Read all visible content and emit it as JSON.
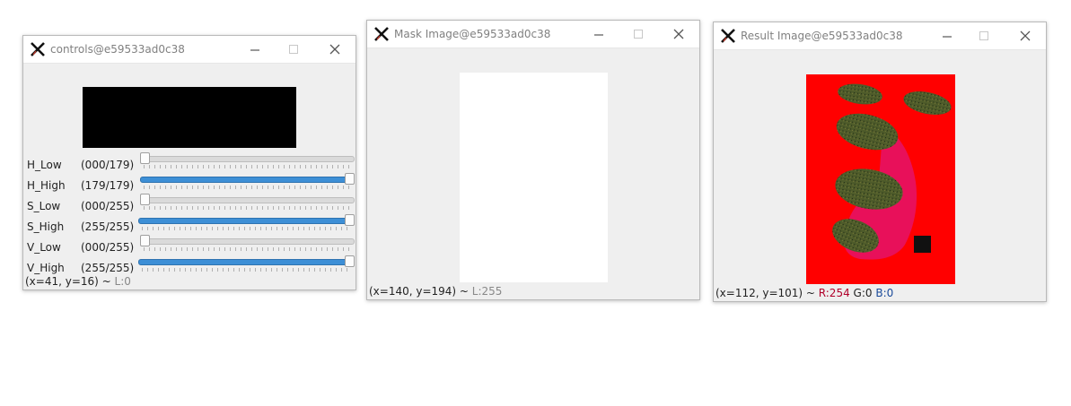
{
  "controls_window": {
    "title": "controls@e59533ad0c38",
    "trackbars": [
      {
        "label": "H_Low",
        "value_text": "(000/179)",
        "value": 0,
        "max": 179
      },
      {
        "label": "H_High",
        "value_text": "(179/179)",
        "value": 179,
        "max": 179
      },
      {
        "label": "S_Low",
        "value_text": "(000/255)",
        "value": 0,
        "max": 255
      },
      {
        "label": "S_High",
        "value_text": "(255/255)",
        "value": 255,
        "max": 255
      },
      {
        "label": "V_Low",
        "value_text": "(000/255)",
        "value": 0,
        "max": 255
      },
      {
        "label": "V_High",
        "value_text": "(255/255)",
        "value": 255,
        "max": 255
      }
    ],
    "status": {
      "coords": "(x=41, y=16) ~ ",
      "l": "L:0"
    }
  },
  "mask_window": {
    "title": "Mask Image@e59533ad0c38",
    "status": {
      "coords": "(x=140, y=194) ~ ",
      "l": "L:255"
    }
  },
  "result_window": {
    "title": "Result Image@e59533ad0c38",
    "status": {
      "coords": "(x=112, y=101) ~ ",
      "r": "R:254",
      "g": "G:0",
      "b": "B:0"
    }
  },
  "icons": {
    "app": "x-app-icon",
    "minimize": "minimize-icon",
    "maximize": "maximize-icon",
    "close": "close-icon"
  },
  "colors": {
    "accent": "#3d8fd6",
    "result_background": "#ff0000",
    "mask_fill": "#ffffff",
    "leaf": "#4f5a2a",
    "pink_region": "#e8105a"
  }
}
